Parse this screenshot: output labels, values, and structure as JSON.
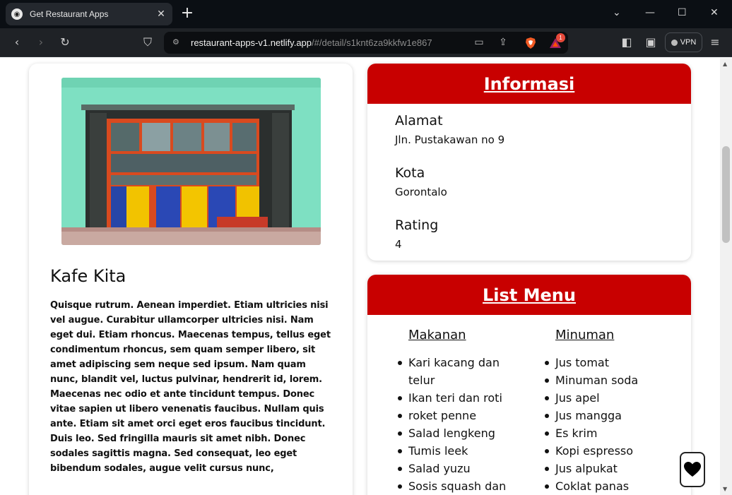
{
  "browser": {
    "tab_title": "Get Restaurant Apps",
    "tab_close": "✕",
    "new_tab": "+",
    "url_host": "restaurant-apps-v1.netlify.app",
    "url_path": "/#/detail/s1knt6za9kkfw1e867",
    "rewards_badge": "1",
    "vpn_label": "VPN"
  },
  "restaurant": {
    "name": "Kafe Kita",
    "description": "Quisque rutrum. Aenean imperdiet. Etiam ultricies nisi vel augue. Curabitur ullamcorper ultricies nisi. Nam eget dui. Etiam rhoncus. Maecenas tempus, tellus eget condimentum rhoncus, sem quam semper libero, sit amet adipiscing sem neque sed ipsum. Nam quam nunc, blandit vel, luctus pulvinar, hendrerit id, lorem. Maecenas nec odio et ante tincidunt tempus. Donec vitae sapien ut libero venenatis faucibus. Nullam quis ante. Etiam sit amet orci eget eros faucibus tincidunt. Duis leo. Sed fringilla mauris sit amet nibh. Donec sodales sagittis magna. Sed consequat, leo eget bibendum sodales, augue velit cursus nunc,"
  },
  "info": {
    "title": "Informasi",
    "address_label": "Alamat",
    "address_value": "Jln. Pustakawan no 9",
    "city_label": "Kota",
    "city_value": "Gorontalo",
    "rating_label": "Rating",
    "rating_value": "4"
  },
  "menu": {
    "title": "List Menu",
    "foods_title": "Makanan",
    "drinks_title": "Minuman",
    "foods": [
      "Kari kacang dan telur",
      "Ikan teri dan roti",
      "roket penne",
      "Salad lengkeng",
      "Tumis leek",
      "Salad yuzu",
      "Sosis squash dan"
    ],
    "drinks": [
      "Jus tomat",
      "Minuman soda",
      "Jus apel",
      "Jus mangga",
      "Es krim",
      "Kopi espresso",
      "Jus alpukat",
      "Coklat panas"
    ]
  },
  "colors": {
    "accent": "#c80000",
    "chrome_bg": "#1f2226"
  },
  "icons": [
    "restaurant-favicon",
    "back-icon",
    "forward-icon",
    "reload-icon",
    "bookmark-icon",
    "site-info-icon",
    "cast-icon",
    "share-icon",
    "brave-shields-icon",
    "brave-rewards-icon",
    "sidebar-icon",
    "wallet-icon",
    "menu-icon",
    "heart-icon"
  ]
}
